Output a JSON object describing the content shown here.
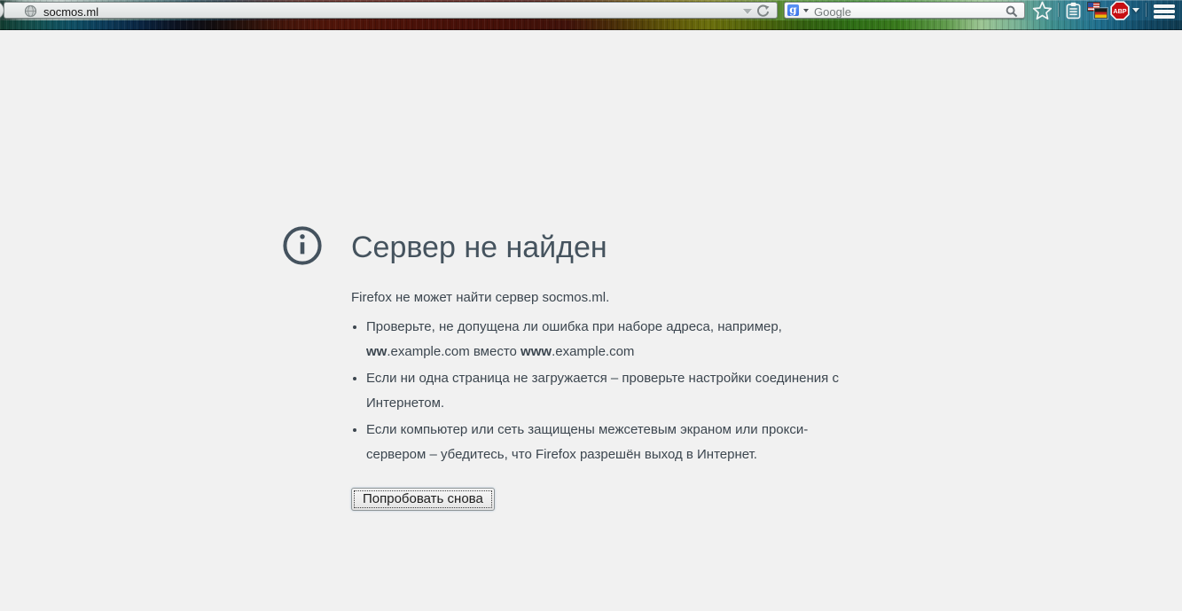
{
  "toolbar": {
    "url_value": "socmos.ml",
    "search_placeholder": "Google",
    "search_engine_initial": "g",
    "adblock_label": "ABP"
  },
  "icons": {
    "site": "globe",
    "url_dropdown": "chevron-down",
    "reload": "circular-arrow",
    "search_engine": "google-g-badge",
    "search": "magnifier",
    "bookmark": "star-outline",
    "clipboard_addon": "clipboard",
    "translator_addon": "us-and-german-flags",
    "adblock_addon": "red-stop-octagon",
    "menu": "hamburger",
    "error": "info-circle"
  },
  "colors": {
    "content_bg": "#f1f1f1",
    "text": "#45535e",
    "abp_red": "#c60f13",
    "google_blue": "#4a84f4"
  },
  "page": {
    "title": "Сервер не найден",
    "description": "Firefox не может найти сервер socmos.ml.",
    "bullets": [
      {
        "lines": [
          [
            {
              "t": "Проверьте, не допущена ли ошибка при наборе адреса, например,",
              "b": false
            }
          ],
          [
            {
              "t": "ww",
              "b": true
            },
            {
              "t": ".example.com вместо ",
              "b": false
            },
            {
              "t": "www",
              "b": true
            },
            {
              "t": ".example.com",
              "b": false
            }
          ]
        ]
      },
      {
        "lines": [
          [
            {
              "t": "Если ни одна страница не загружается – проверьте настройки соединения с",
              "b": false
            }
          ],
          [
            {
              "t": "Интернетом.",
              "b": false
            }
          ]
        ]
      },
      {
        "lines": [
          [
            {
              "t": "Если компьютер или сеть защищены межсетевым экраном или прокси-",
              "b": false
            }
          ],
          [
            {
              "t": "сервером – убедитесь, что Firefox разрешён выход в Интернет.",
              "b": false
            }
          ]
        ]
      }
    ],
    "retry_label": "Попробовать снова"
  }
}
